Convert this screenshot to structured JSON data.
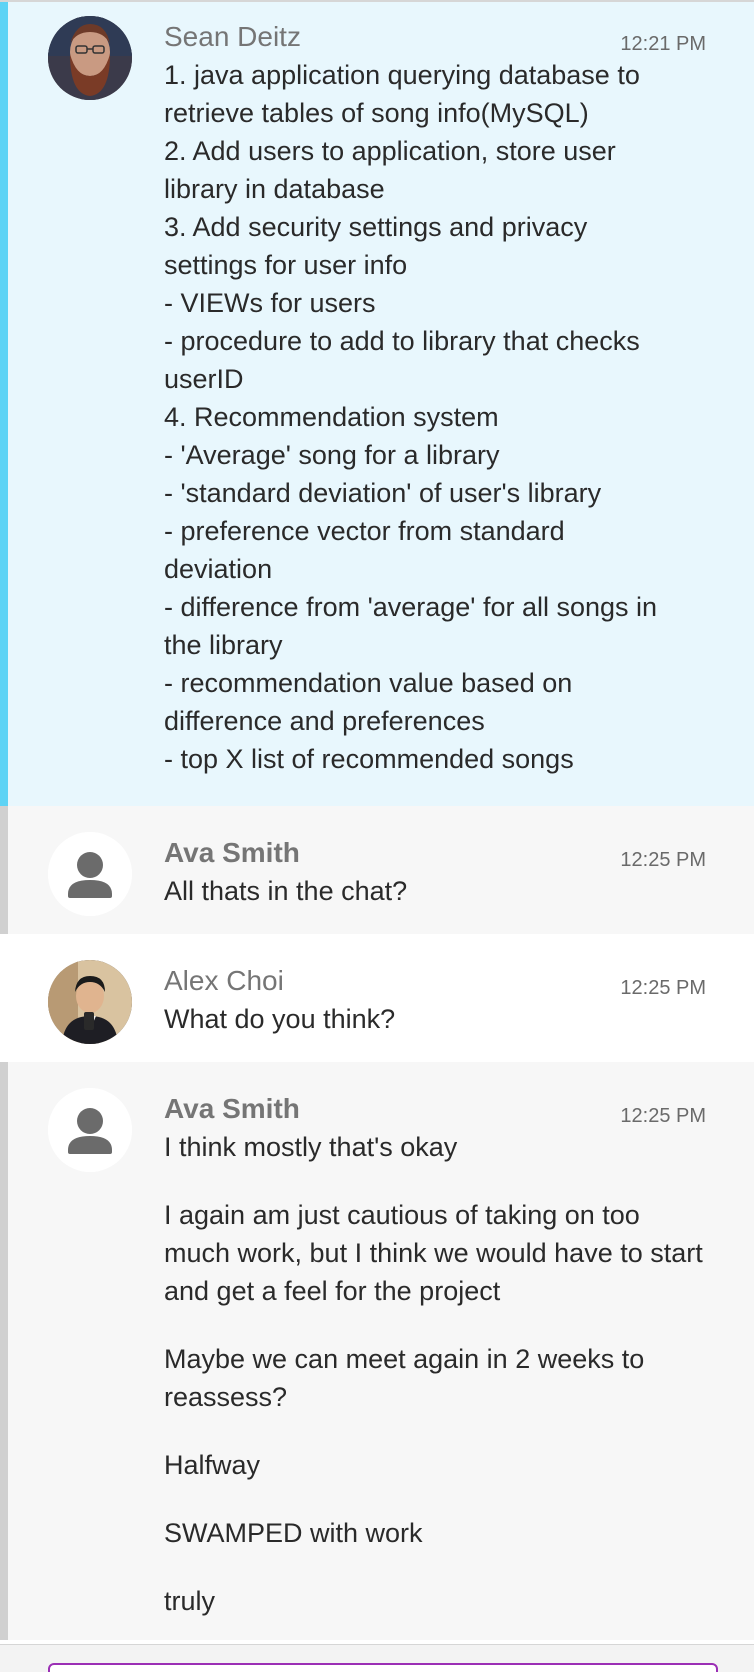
{
  "messages": [
    {
      "sender": "Sean Deitz",
      "time": "12:21 PM",
      "avatar": "bearded-man-photo",
      "lines": [
        "1. java application querying database to",
        "retrieve tables of song info(MySQL)",
        "2. Add users to application, store user",
        "library in database",
        "3. Add security settings and privacy",
        "settings for user info",
        "- VIEWs for users",
        "- procedure to add to library that checks",
        "userID",
        "4. Recommendation system",
        "- 'Average' song for a library",
        "- 'standard deviation' of user's library",
        "- preference vector from standard",
        "deviation",
        "- difference from 'average' for all songs in",
        "the library",
        "- recommendation value based on",
        "difference and preferences",
        "- top X list of recommended songs"
      ]
    },
    {
      "sender": "Ava Smith",
      "time": "12:25 PM",
      "avatar": "default-person-icon",
      "lines": [
        "All thats in the chat?"
      ]
    },
    {
      "sender": "Alex Choi",
      "time": "12:25 PM",
      "avatar": "man-in-suit-photo",
      "lines": [
        "What do you think?"
      ]
    },
    {
      "sender": "Ava Smith",
      "time": "12:25 PM",
      "avatar": "default-person-icon",
      "paragraphs": [
        "I think mostly that's okay",
        "I again am just cautious of taking on too much work, but I think we would have to start and get a feel for the project",
        "Maybe we can meet again in 2 weeks to reassess?",
        "Halfway",
        "SWAMPED with work",
        "truly"
      ]
    }
  ],
  "colors": {
    "highlight_bg": "#e8f7fd",
    "highlight_stripe": "#5dd3f5",
    "grey_bg": "#f7f7f7",
    "grey_stripe": "#d0d0d0",
    "composer_border": "#9b2fb5"
  }
}
